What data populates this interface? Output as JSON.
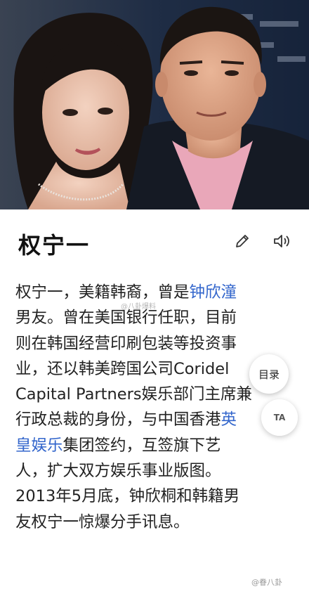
{
  "article": {
    "title": "权宁一",
    "lines": [
      [
        {
          "t": "权宁一，美籍韩裔，曾是"
        },
        {
          "t": "钟欣潼",
          "link": true
        }
      ],
      [
        {
          "t": "男友。曾在美国银行任职，目前"
        }
      ],
      [
        {
          "t": "则在韩国经营印刷包装等投资事"
        }
      ],
      [
        {
          "t": "业，还以韩美跨国公司Coridel"
        }
      ],
      [
        {
          "t": "Capital Partners娱乐部门主席兼"
        }
      ],
      [
        {
          "t": "行政总裁的身份，与中国香港"
        },
        {
          "t": "英",
          "link": true
        }
      ],
      [
        {
          "t": "皇娱乐",
          "link": true
        },
        {
          "t": "集团签约，互签旗下艺"
        }
      ],
      [
        {
          "t": "人，扩大双方娱乐事业版图。"
        }
      ],
      [
        {
          "t": "2013年5月底，钟欣桐和韩籍男"
        }
      ],
      [
        {
          "t": "友权宁一惊爆分手讯息。"
        }
      ]
    ]
  },
  "toolbar": {
    "edit_icon": "pencil-icon",
    "speaker_icon": "speaker-icon"
  },
  "toc_button": {
    "label": "目录"
  },
  "top_button": {
    "label": "TA"
  },
  "watermarks": {
    "middle": "@八卦爆料",
    "bottom": "@眷八卦"
  },
  "colors": {
    "link": "#3366cc",
    "text": "#222222",
    "title": "#111111"
  }
}
